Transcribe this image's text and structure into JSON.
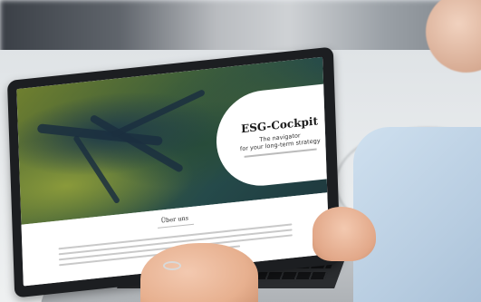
{
  "screen": {
    "hero_title": "ESG-Cockpit",
    "hero_subtitle_line1": "The navigator",
    "hero_subtitle_line2": "for your long-term strategy",
    "about_title": "Über uns"
  },
  "colors": {
    "screen_bg": "#ffffff",
    "laptop_frame": "#1c1e21",
    "sleeve": "#b8cde1"
  }
}
